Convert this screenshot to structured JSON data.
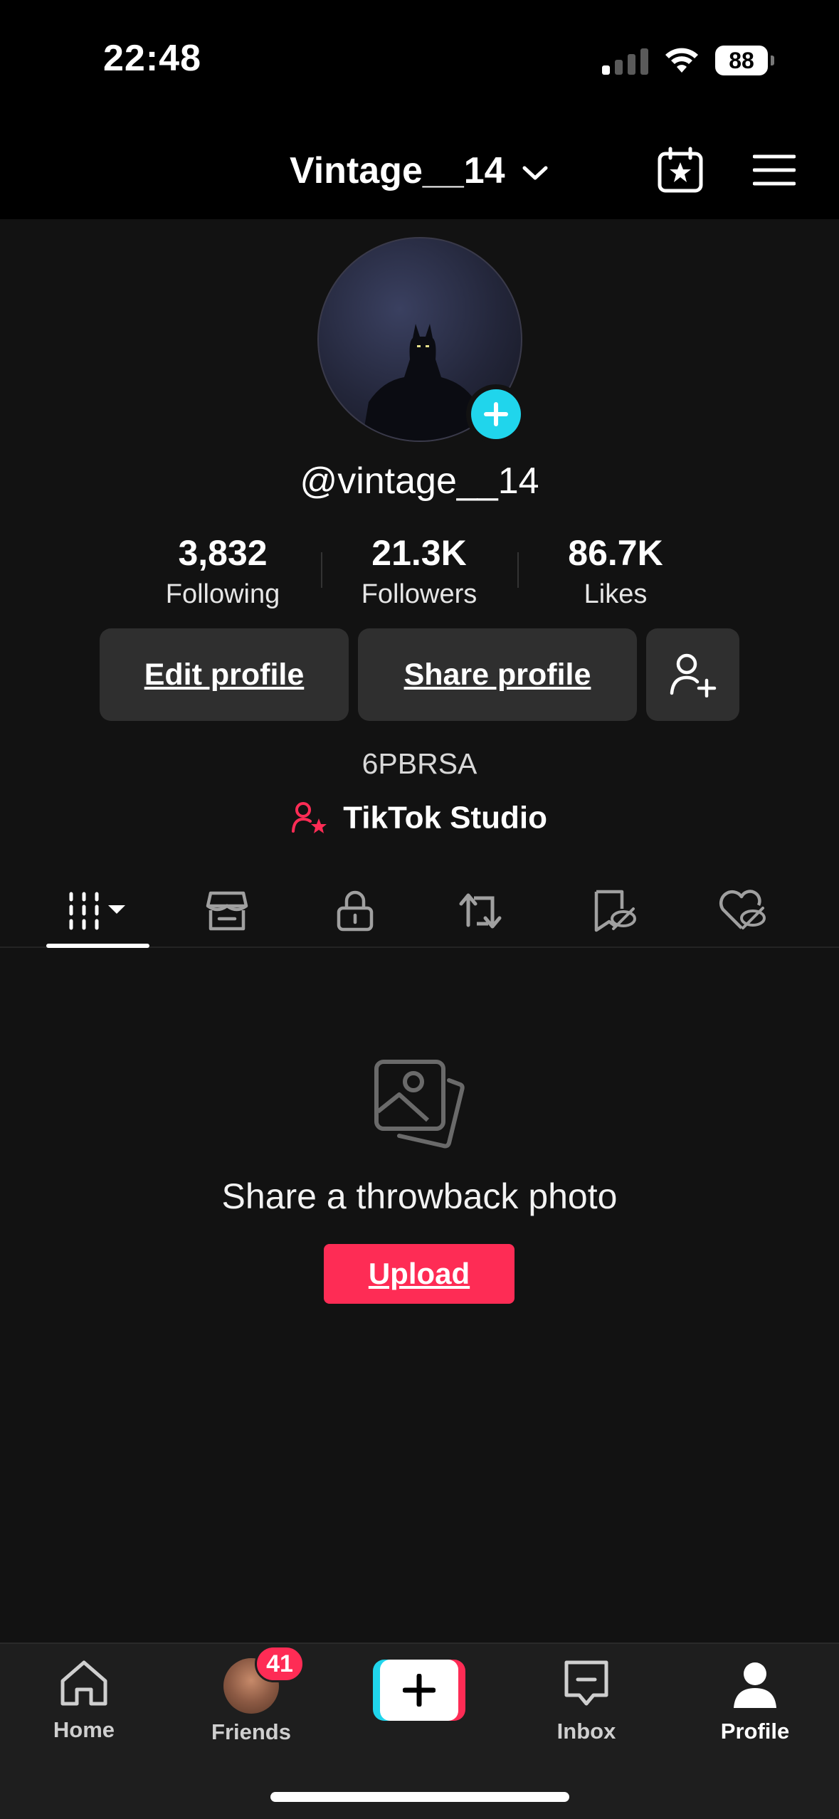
{
  "status_bar": {
    "time": "22:48",
    "battery": "88"
  },
  "header": {
    "username": "Vintage__14"
  },
  "profile": {
    "handle": "@vintage__14",
    "stats": [
      {
        "value": "3,832",
        "label": "Following"
      },
      {
        "value": "21.3K",
        "label": "Followers"
      },
      {
        "value": "86.7K",
        "label": "Likes"
      }
    ],
    "edit_profile_label": "Edit profile",
    "share_profile_label": "Share profile",
    "code": "6PBRSA",
    "studio_label": "TikTok Studio"
  },
  "tabs": [
    {
      "icon": "videos-grid-icon",
      "selected": true
    },
    {
      "icon": "shop-icon",
      "selected": false
    },
    {
      "icon": "lock-icon",
      "selected": false
    },
    {
      "icon": "repost-icon",
      "selected": false
    },
    {
      "icon": "favorites-hidden-icon",
      "selected": false
    },
    {
      "icon": "liked-hidden-icon",
      "selected": false
    }
  ],
  "empty_state": {
    "title": "Share a throwback photo",
    "upload_label": "Upload"
  },
  "bottom_nav": {
    "home": "Home",
    "friends": "Friends",
    "friends_badge": "41",
    "inbox": "Inbox",
    "profile": "Profile"
  },
  "colors": {
    "accent": "#fe2c55",
    "cyan": "#20d5ec",
    "background": "#121212"
  }
}
